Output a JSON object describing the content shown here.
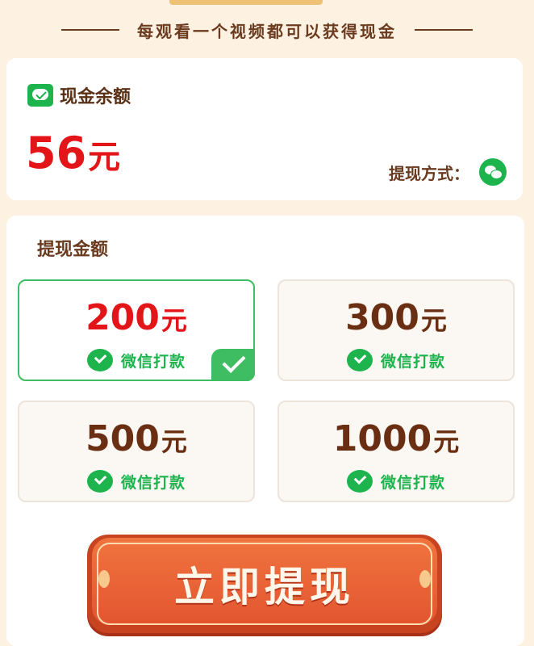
{
  "header": {
    "subtitle": "每观看一个视频都可以获得现金"
  },
  "balance": {
    "label": "现金余额",
    "amount": "56",
    "unit": "元",
    "method_label": "提现方式："
  },
  "withdraw": {
    "title": "提现金额",
    "options": [
      {
        "amount": "200",
        "unit": "元",
        "pay": "微信打款",
        "selected": true
      },
      {
        "amount": "300",
        "unit": "元",
        "pay": "微信打款",
        "selected": false
      },
      {
        "amount": "500",
        "unit": "元",
        "pay": "微信打款",
        "selected": false
      },
      {
        "amount": "1000",
        "unit": "元",
        "pay": "微信打款",
        "selected": false
      }
    ],
    "button_label": "立即提现"
  },
  "colors": {
    "accent_red": "#e31518",
    "wechat_green": "#1db34d",
    "selected_border": "#3fbd63",
    "button_orange": "#e35530",
    "brown_text": "#6a3b1f"
  },
  "icons": {
    "wechat": "wechat-icon",
    "check": "check-icon"
  }
}
